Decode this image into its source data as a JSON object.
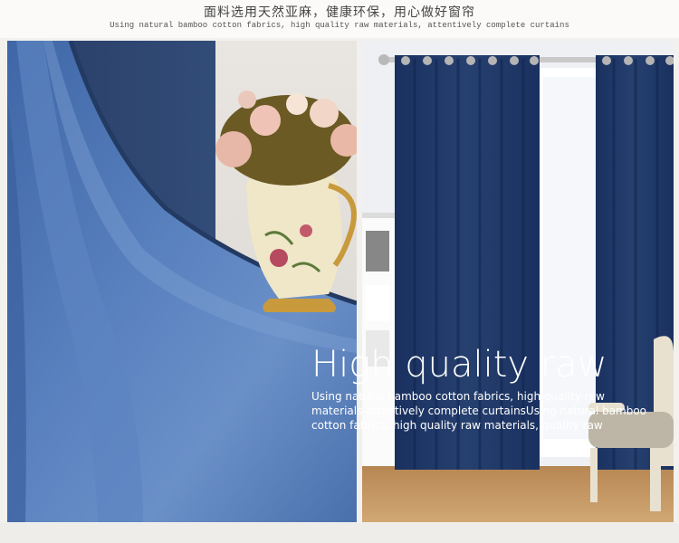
{
  "header": {
    "title_zh": "面料选用天然亚麻，健康环保，用心做好窗帘",
    "subtitle_en": "Using natural bamboo cotton fabrics, high quality raw materials, attentively complete curtains"
  },
  "overlay": {
    "title": "High quality raw",
    "body": "Using natural bamboo cotton fabrics, high quality raw materials attentively complete curtainsUsing natural bamboo cotton fabrics, high quality raw materials,  quality raw"
  },
  "colors": {
    "curtain_navy": "#1f3868",
    "curtain_blue": "#4b72ad",
    "floor_wood": "#c79a66",
    "vase_cream": "#efe7c8",
    "gold": "#c89a3c"
  }
}
